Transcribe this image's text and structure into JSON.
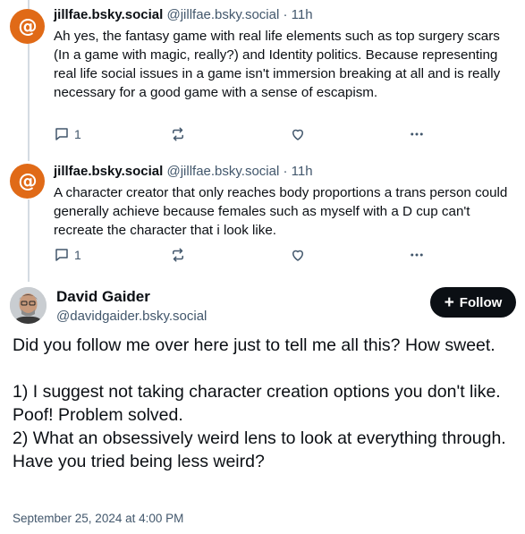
{
  "posts": [
    {
      "display_name": "jillfae.bsky.social",
      "meta": "@jillfae.bsky.social · 11h",
      "text": "Ah yes, the fantasy game with real life elements such as top surgery scars (In a game with magic, really?) and Identity politics. Because representing real life social issues in a game isn't immersion breaking at all and is really necessary for a good game with a sense of escapism.",
      "reply_count": "1",
      "avatar_icon": "at-sign-icon"
    },
    {
      "display_name": "jillfae.bsky.social",
      "meta": "@jillfae.bsky.social · 11h",
      "text": "A character creator that only reaches body proportions a trans person could generally achieve because females such as myself with a D cup can't recreate the character that i look like.",
      "reply_count": "1",
      "avatar_icon": "at-sign-icon"
    }
  ],
  "main_post": {
    "display_name": "David Gaider",
    "handle": "@davidgaider.bsky.social",
    "follow_label": "Follow",
    "text": "Did you follow me over here just to tell me all this? How sweet.\n\n1) I suggest not taking character creation options you don't like. Poof! Problem solved.\n2) What an obsessively weird lens to look at everything through. Have you tried being less weird?",
    "timestamp": "September 25, 2024 at 4:00 PM"
  },
  "colors": {
    "avatar_orange": "#e06a17",
    "secondary_text": "#42576c",
    "thread_line": "#d4dbe2",
    "follow_bg": "#0b0f14"
  }
}
